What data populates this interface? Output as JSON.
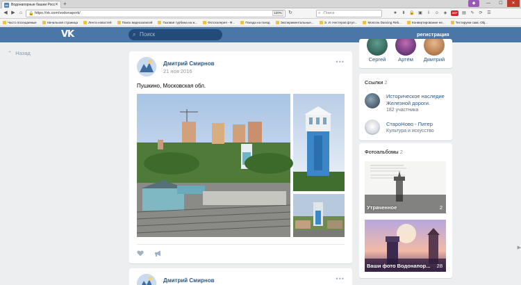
{
  "browser": {
    "tab_title": "Водонапорные башни Росс",
    "url": "https://vk.com/vodonapork/",
    "zoom": "120%",
    "search_placeholder": "Поиск",
    "bookmarks": [
      "Часто посещаемые",
      "Начальная страница",
      "Лента новостей",
      "Поиск видеозаписей",
      "Газовая турбина на ж...",
      "Фотогалерея - Ф...",
      "Поезда на поезд",
      "Экспериментальные...",
      "Э. И. Нестеров фтул...",
      "Moscow Dancing Reb...",
      "Конвертирование не...",
      "Тестируем самі. Obj..."
    ]
  },
  "vk": {
    "logo": "VK",
    "search_placeholder": "Поиск",
    "register": "регистрация",
    "back": "Назад",
    "brand_color": "#4a76a8"
  },
  "posts": [
    {
      "author": "Дмитрий Смирнов",
      "date": "21 ноя 2016",
      "text": "Пушкино, Московская обл.",
      "more": "•••"
    },
    {
      "author": "Дмитрий Смирнов",
      "more": "•••"
    }
  ],
  "sidebar": {
    "members": [
      "Сергей",
      "Артём",
      "Дмитрий"
    ],
    "links_title": "Ссылки",
    "links_count": "2",
    "links": [
      {
        "title": "Историческое наследие Железной дороги.",
        "sub": "182 участника"
      },
      {
        "title": "СтароНово - Питер",
        "sub": "Культура и искусство"
      }
    ],
    "albums_title": "Фотоальбомы",
    "albums_count": "2",
    "albums": [
      {
        "name": "Утраченное",
        "count": "2"
      },
      {
        "name": "Ваши фото Водонапор...",
        "count": "28"
      }
    ]
  }
}
